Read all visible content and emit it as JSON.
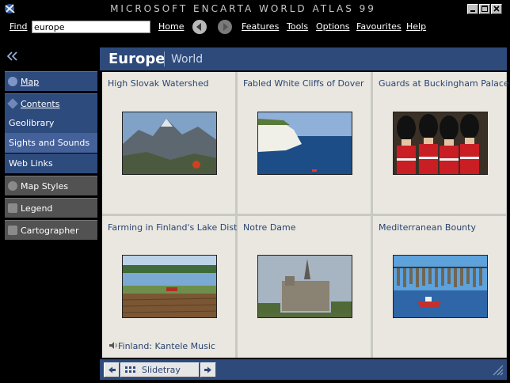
{
  "window": {
    "title": "MICROSOFT ENCARTA WORLD ATLAS 99",
    "controls": [
      "minimize",
      "maximize",
      "close"
    ]
  },
  "menubar": {
    "find_label": "Find",
    "find_value": "europe",
    "home": "Home",
    "features": "Features",
    "tools": "Tools",
    "options": "Options",
    "favourites": "Favourites",
    "help": "Help"
  },
  "sidebar": {
    "collapse_icon": "double-chevron-left-icon",
    "items": [
      {
        "label": "Map",
        "style": "blue",
        "icon": "globe-icon"
      },
      {
        "label": "Contents",
        "style": "blue",
        "icon": "diamond-icon"
      },
      {
        "label": "Geolibrary",
        "style": "blue-sub"
      },
      {
        "label": "Sights and Sounds",
        "style": "blue-sub-selected"
      },
      {
        "label": "Web Links",
        "style": "blue-sub"
      },
      {
        "label": "Map Styles",
        "style": "gray",
        "icon": "map-styles-icon"
      },
      {
        "label": "Legend",
        "style": "gray",
        "icon": "legend-key-icon"
      },
      {
        "label": "Cartographer",
        "style": "gray",
        "icon": "cartographer-icon"
      }
    ]
  },
  "header": {
    "title": "Europe",
    "subtitle": "World"
  },
  "media": [
    {
      "title": "High Slovak Watershed"
    },
    {
      "title": "Fabled White Cliffs of Dover"
    },
    {
      "title": "Guards at Buckingham Palace"
    },
    {
      "title": "Farming in Finland's Lake District"
    },
    {
      "title": "Notre Dame"
    },
    {
      "title": "Mediterranean Bounty"
    }
  ],
  "audio": {
    "label": "Finland: Kantele Music",
    "icon": "speaker-icon"
  },
  "slidetray": {
    "label": "Slidetray"
  },
  "colors": {
    "panel_blue": "#2d4a7b",
    "sidebar_gray": "#525252",
    "cell_bg": "#e9e7e0",
    "title_text": "#2b4470"
  }
}
